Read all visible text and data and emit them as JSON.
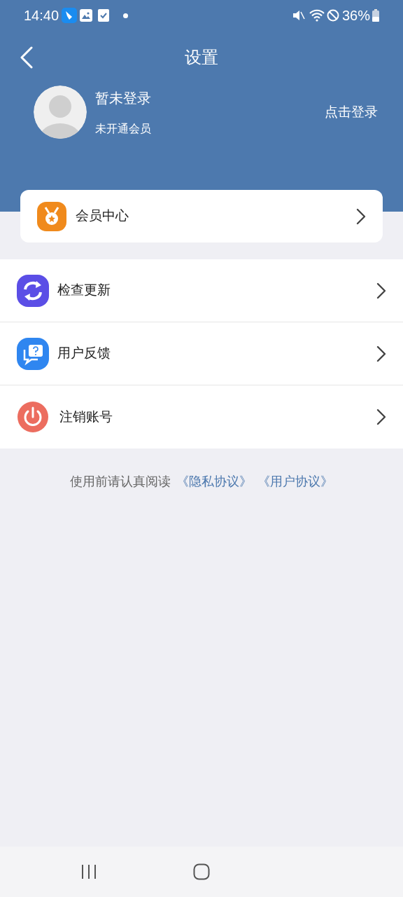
{
  "status_bar": {
    "time": "14:40",
    "battery": "36%"
  },
  "header": {
    "title": "设置",
    "user_name": "暂未登录",
    "membership": "未开通会员",
    "login_link": "点击登录"
  },
  "member_card": {
    "label": "会员中心"
  },
  "menu": [
    {
      "kind": "update",
      "label": "检查更新"
    },
    {
      "kind": "feedback",
      "label": "用户反馈"
    },
    {
      "kind": "logout",
      "label": "注销账号"
    }
  ],
  "footer": {
    "text": "使用前请认真阅读",
    "links": [
      "《隐私协议》",
      "《用户协议》"
    ]
  }
}
